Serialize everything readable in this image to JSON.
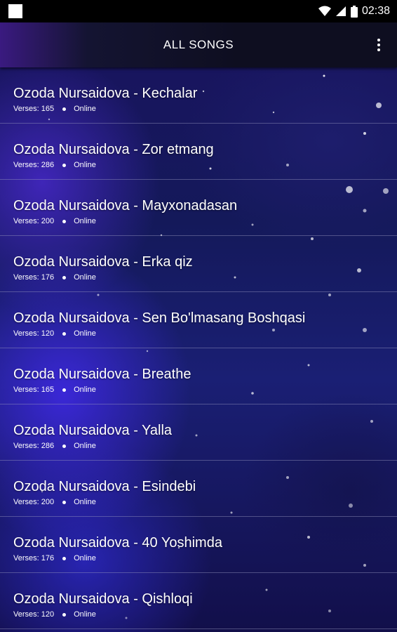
{
  "status_bar": {
    "time": "02:38",
    "icons": [
      "notification-square-icon",
      "wifi-icon",
      "signal-icon",
      "battery-icon"
    ]
  },
  "app_bar": {
    "title": "ALL SONGS",
    "overflow_icon": "more-vert-icon"
  },
  "songs": [
    {
      "title": "Ozoda Nursaidova - Kechalar",
      "verses": "Verses: 165",
      "status": "Online"
    },
    {
      "title": "Ozoda Nursaidova - Zor etmang",
      "verses": "Verses: 286",
      "status": "Online"
    },
    {
      "title": "Ozoda Nursaidova - Mayxonadasan",
      "verses": "Verses: 200",
      "status": "Online"
    },
    {
      "title": "Ozoda Nursaidova - Erka qiz",
      "verses": "Verses: 176",
      "status": "Online"
    },
    {
      "title": "Ozoda Nursaidova - Sen Bo'lmasang Boshqasi",
      "verses": "Verses: 120",
      "status": "Online"
    },
    {
      "title": "Ozoda Nursaidova - Breathe",
      "verses": "Verses: 165",
      "status": "Online"
    },
    {
      "title": "Ozoda Nursaidova - Yalla",
      "verses": "Verses: 286",
      "status": "Online"
    },
    {
      "title": "Ozoda Nursaidova - Esindebi",
      "verses": "Verses: 200",
      "status": "Online"
    },
    {
      "title": "Ozoda Nursaidova - 40 Yoshimda",
      "verses": "Verses: 176",
      "status": "Online"
    },
    {
      "title": "Ozoda Nursaidova - Qishloqi",
      "verses": "Verses: 120",
      "status": "Online"
    }
  ],
  "colors": {
    "status_bar_bg": "#000000",
    "app_bar_bg": "#0e0e20",
    "text": "#ffffff",
    "divider": "#9696be"
  }
}
